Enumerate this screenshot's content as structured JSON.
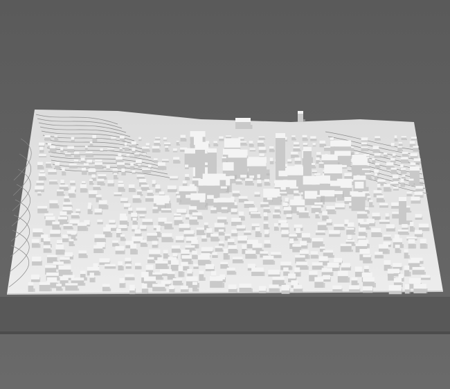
{
  "scene": {
    "subject": "white-city-model",
    "colors": {
      "background_top": "#5a5a5a",
      "background_bottom": "#6a6a6a",
      "plinth_front": "#585858",
      "plinth_shadow": "#4c4c4c",
      "model_surface": "#e6e6e6",
      "model_edge": "#cfcfcf",
      "contour_line": "#8a8a8a",
      "building_top": "#f4f4f4",
      "building_side": "#c9c9c9",
      "building_shadow": "#b5b5b5"
    }
  }
}
